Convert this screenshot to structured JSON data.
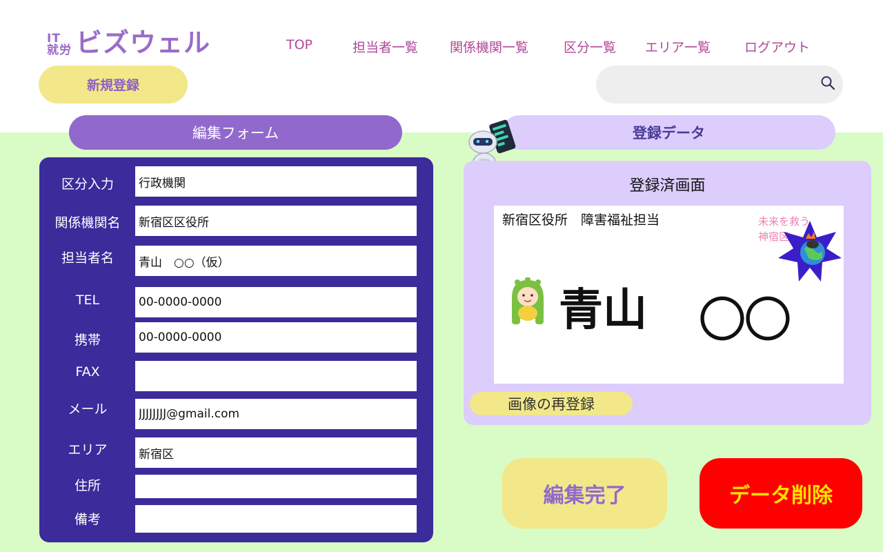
{
  "logo": {
    "small_line1": "IT",
    "small_line2": "就労",
    "main": "ビズウェル"
  },
  "nav": {
    "items": [
      "TOP",
      "担当者一覧",
      "関係機関一覧",
      "区分一覧",
      "エリア一覧",
      "ログアウト"
    ]
  },
  "new_button": "新規登録",
  "search": {
    "value": "",
    "placeholder": ""
  },
  "edit_form": {
    "title": "編集フォーム",
    "fields": [
      {
        "label": "区分入力",
        "value": "行政機関"
      },
      {
        "label": "関係機関名",
        "value": "新宿区区役所"
      },
      {
        "label": "担当者名",
        "value": "青山　○○（仮）"
      },
      {
        "label": "TEL",
        "value": "00-0000-0000"
      },
      {
        "label": "携帯",
        "value": "00-0000-0000"
      },
      {
        "label": "FAX",
        "value": ""
      },
      {
        "label": "メール",
        "value": "JJJJJJJJ@gmail.com"
      },
      {
        "label": "エリア",
        "value": "新宿区"
      },
      {
        "label": "住所",
        "value": ""
      },
      {
        "label": "備考",
        "value": ""
      }
    ]
  },
  "data_panel": {
    "title": "登録データ",
    "screen_title": "登録済画面",
    "card": {
      "org": "新宿区役所　障害福祉担当",
      "slogan_line1": "未来を救う",
      "slogan_line2": "神宿区",
      "name": "青山",
      "name_suffix": "〇〇"
    },
    "reupload_button": "画像の再登録"
  },
  "complete_button": "編集完了",
  "delete_button": "データ削除",
  "colors": {
    "accent_purple": "#9169cc",
    "form_navy": "#3b2b9b",
    "yellow": "#f2e88a",
    "delete_red": "#ff0000",
    "green_bg": "#d9fcc6"
  }
}
